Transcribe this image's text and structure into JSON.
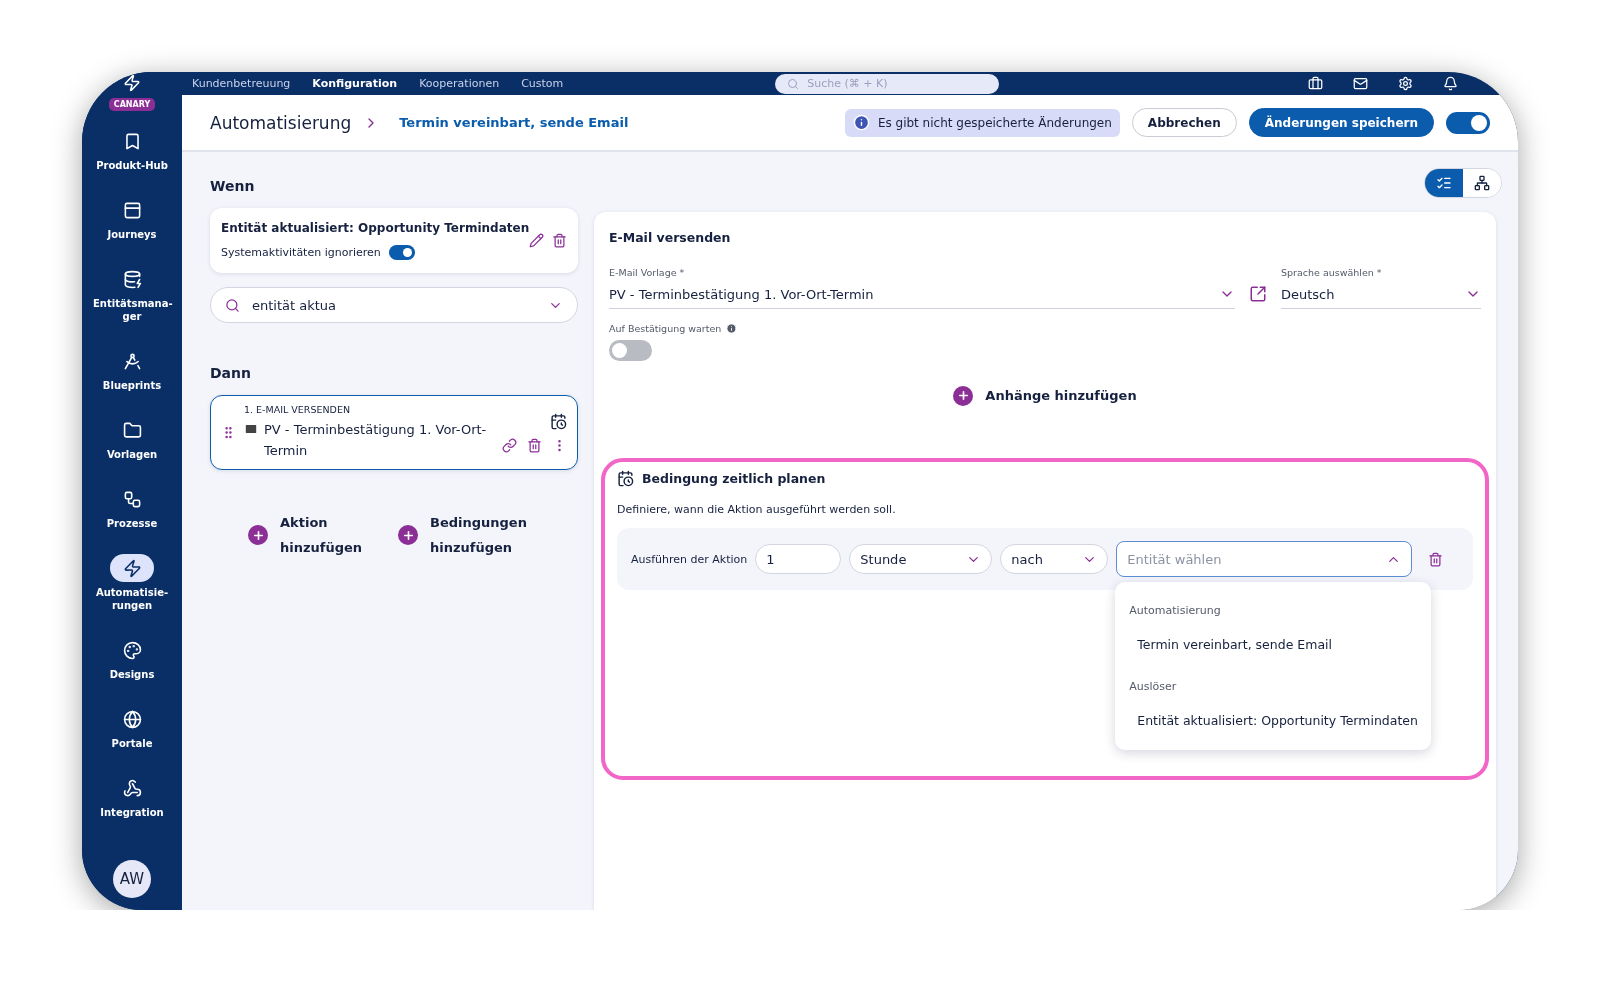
{
  "app": {
    "logo_badge": "CANARY",
    "nav": [
      {
        "label": "Kundenbetreuung",
        "selected": false
      },
      {
        "label": "Konfiguration",
        "selected": true
      },
      {
        "label": "Kooperationen",
        "selected": false
      },
      {
        "label": "Custom",
        "selected": false
      }
    ],
    "search": {
      "placeholder": "Suche (⌘ + K)"
    }
  },
  "sidebar": {
    "items": [
      {
        "kind": "hub",
        "label": "Produkt-Hub",
        "selected": false
      },
      {
        "kind": "journeys",
        "label": "Journeys",
        "selected": false
      },
      {
        "kind": "entities",
        "label": "Entitätsmana-ger",
        "selected": false
      },
      {
        "kind": "blueprints",
        "label": "Blueprints",
        "selected": false
      },
      {
        "kind": "templates",
        "label": "Vorlagen",
        "selected": false
      },
      {
        "kind": "processes",
        "label": "Prozesse",
        "selected": false
      },
      {
        "kind": "automations",
        "label": "Automatisie-rungen",
        "selected": true
      },
      {
        "kind": "designs",
        "label": "Designs",
        "selected": false
      },
      {
        "kind": "portals",
        "label": "Portale",
        "selected": false
      },
      {
        "kind": "integration",
        "label": "Integration",
        "selected": false
      }
    ],
    "avatar": "AW"
  },
  "header": {
    "title": "Automatisierung",
    "breadcrumb": "Termin vereinbart, sende Email",
    "notice": "Es gibt nicht gespeicherte Änderungen",
    "cancel": "Abbrechen",
    "save": "Änderungen speichern",
    "enabled": true
  },
  "view_switch": [
    {
      "kind": "list",
      "selected": true
    },
    {
      "kind": "tree",
      "selected": false
    }
  ],
  "trigger": {
    "heading": "Wenn",
    "title": "Entität aktualisiert: Opportunity Termindaten",
    "ignore_label": "Systemaktivitäten ignorieren",
    "ignore_on": true,
    "search_value": "entität aktua"
  },
  "actions": {
    "heading": "Dann",
    "items": [
      {
        "step": "1. E-MAIL VERSENDEN",
        "title": "PV - Terminbestätigung 1. Vor-Ort-Termin",
        "selected": true
      }
    ],
    "add_buttons": [
      "Aktion hinzufügen",
      "Bedingungen hinzufügen"
    ]
  },
  "panel": {
    "title": "E-Mail versenden",
    "template_label": "E-Mail Vorlage *",
    "template_value": "PV - Terminbestätigung 1. Vor-Ort-Termin",
    "language_label": "Sprache auswählen *",
    "language_value": "Deutsch",
    "confirm_label": "Auf Bestätigung warten",
    "confirm_on": false,
    "attach": "Anhänge hinzufügen",
    "schedule": {
      "highlighted": true,
      "title": "Bedingung zeitlich planen",
      "description": "Definiere, wann die Aktion ausgeführt werden soll.",
      "row_label": "Ausführen der Aktion",
      "amount": "1",
      "unit": "Stunde",
      "relation": "nach",
      "entity_placeholder": "Entität wählen",
      "expanded": true,
      "menu": [
        {
          "label": "Automatisierung",
          "options": [
            "Termin vereinbart, sende Email"
          ]
        },
        {
          "label": "Auslöser",
          "options": [
            "Entität aktualisiert: Opportunity Termindaten"
          ]
        }
      ]
    }
  }
}
